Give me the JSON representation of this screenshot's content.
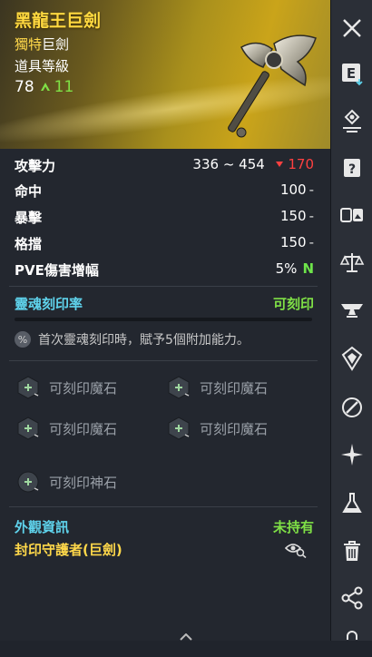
{
  "item": {
    "name": "黑龍王巨劍",
    "rarity_prefix": "獨特",
    "rarity_type": "巨劍",
    "level_label": "道具等級",
    "level_value": "78",
    "level_up": "11"
  },
  "stats": [
    {
      "label": "攻擊力",
      "value": "336 ~ 454",
      "diff": "170"
    },
    {
      "label": "命中",
      "value": "100"
    },
    {
      "label": "暴擊",
      "value": "150"
    },
    {
      "label": "格擋",
      "value": "150"
    },
    {
      "label": "PVE傷害增幅",
      "value": "5%",
      "badge": "N"
    }
  ],
  "dash": "-",
  "soul": {
    "label": "靈魂刻印率",
    "status": "可刻印",
    "progress": 0,
    "note": "首次靈魂刻印時，賦予5個附加能力。"
  },
  "slots": {
    "magic_stone_label": "可刻印魔石",
    "divine_stone_label": "可刻印神石"
  },
  "appearance": {
    "label": "外觀資訊",
    "status": "未持有",
    "name": "封印守護者(巨劍)"
  },
  "sidebar_icons": [
    "close-icon",
    "equip-icon",
    "location-pin-icon",
    "scroll-icon",
    "compare-icon",
    "scale-icon",
    "anvil-icon",
    "crest-icon",
    "link-icon",
    "star-burst-icon",
    "flask-icon",
    "trash-icon",
    "share-icon",
    "lock-icon"
  ],
  "colors": {
    "title": "#ffd940",
    "soul": "#5fd3ec",
    "positive": "#7fe046",
    "negative": "#ff4040"
  }
}
